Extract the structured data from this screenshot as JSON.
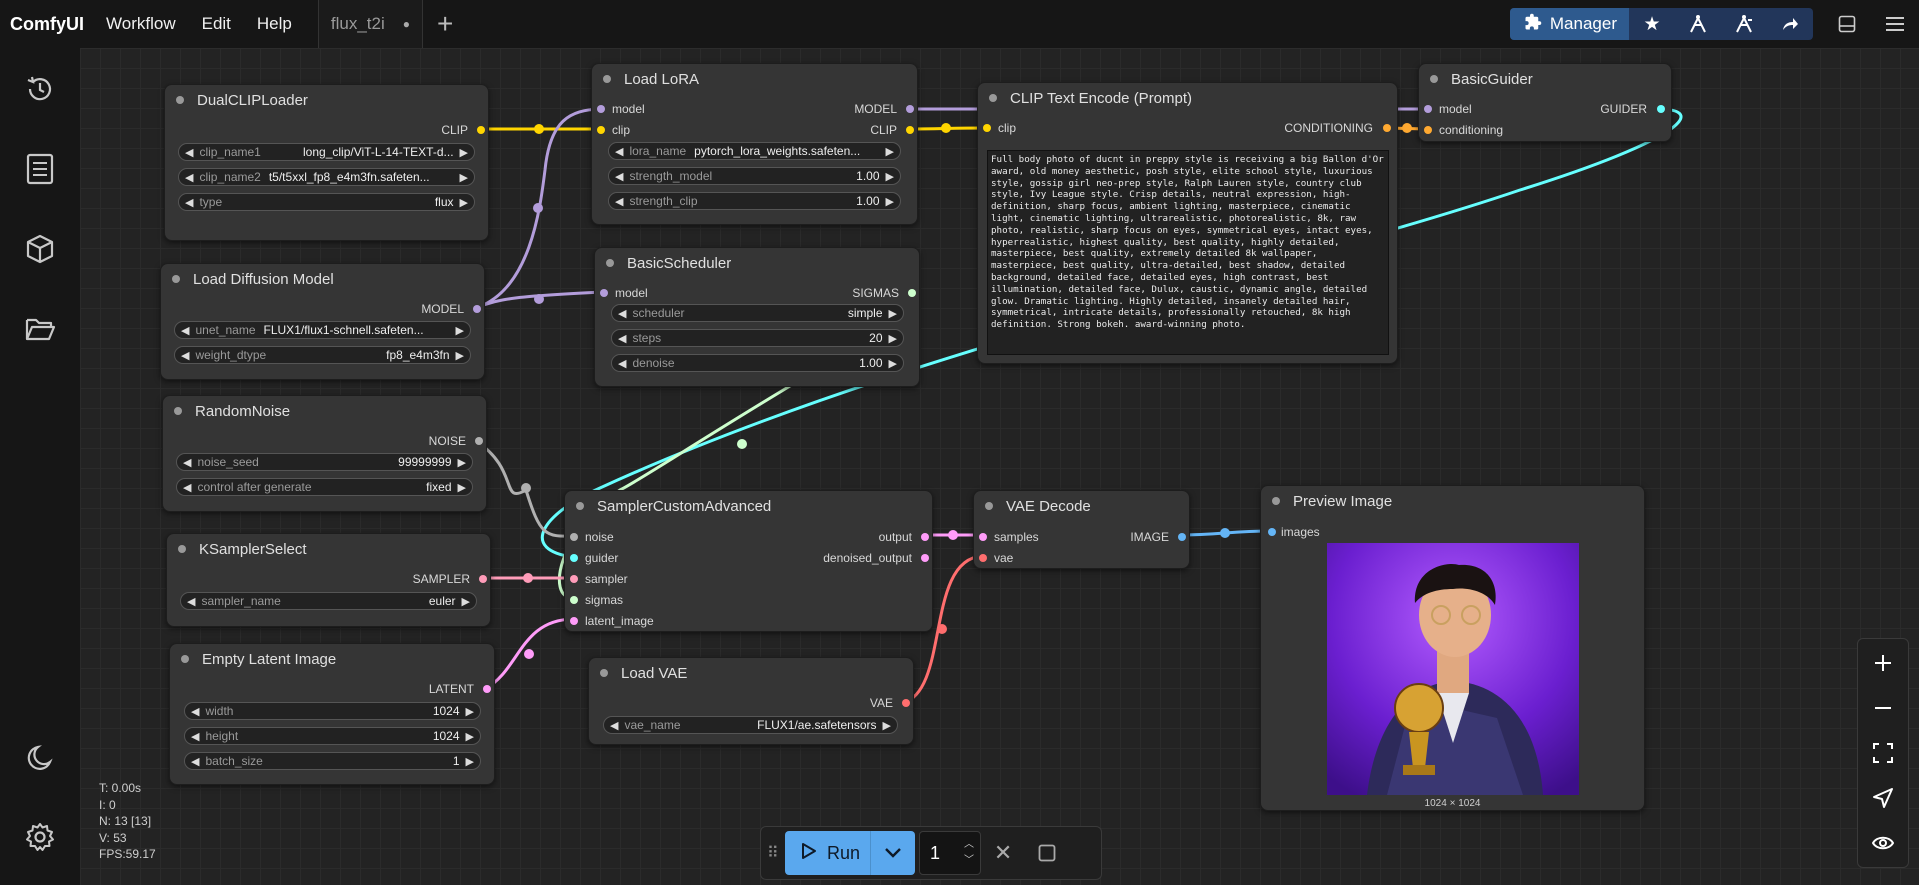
{
  "app": {
    "name": "ComfyUI"
  },
  "menu": {
    "items": [
      "Workflow",
      "Edit",
      "Help"
    ]
  },
  "workflow_tab": {
    "name": "flux_t2i",
    "unsaved_dot": "●"
  },
  "topright": {
    "manager_label": "Manager"
  },
  "stats": {
    "t": "T: 0.00s",
    "i": "I: 0",
    "n": "N: 13 [13]",
    "v": "V: 53",
    "fps": "FPS:59.17"
  },
  "nodes": {
    "dualclip": {
      "title": "DualCLIPLoader",
      "out_clip": "CLIP",
      "widgets": [
        {
          "label": "clip_name1",
          "value": "long_clip/ViT-L-14-TEXT-d..."
        },
        {
          "label": "clip_name2",
          "value": "t5/t5xxl_fp8_e4m3fn.safeten..."
        },
        {
          "label": "type",
          "value": "flux"
        }
      ]
    },
    "loadlora": {
      "title": "Load LoRA",
      "in_model": "model",
      "in_clip": "clip",
      "out_model": "MODEL",
      "out_clip": "CLIP",
      "widgets": [
        {
          "label": "lora_name",
          "value": "pytorch_lora_weights.safeten..."
        },
        {
          "label": "strength_model",
          "value": "1.00"
        },
        {
          "label": "strength_clip",
          "value": "1.00"
        }
      ]
    },
    "cliptext": {
      "title": "CLIP Text Encode (Prompt)",
      "in_clip": "clip",
      "out_cond": "CONDITIONING",
      "prompt": "Full body photo of ducnt in preppy style is receiving a big Ballon d'Or award, old money aesthetic, posh style, elite school style, luxurious style, gossip girl neo-prep style, Ralph Lauren style, country club style, Ivy League style. Crisp details, neutral expression, high-definition, sharp focus, ambient lighting, masterpiece, cinematic light, cinematic lighting, ultrarealistic, photorealistic, 8k, raw photo, realistic, sharp focus on eyes, symmetrical eyes, intact eyes, hyperrealistic, highest quality, best quality, highly detailed, masterpiece, best quality, extremely detailed 8k wallpaper, masterpiece, best quality, ultra-detailed, best shadow, detailed background, detailed face, detailed eyes, high contrast, best illumination, detailed face, Dulux, caustic, dynamic angle, detailed glow. Dramatic lighting. Highly detailed, insanely detailed hair, symmetrical, intricate details, professionally retouched, 8k high definition. Strong bokeh. award-winning photo."
    },
    "basicguider": {
      "title": "BasicGuider",
      "in_model": "model",
      "in_cond": "conditioning",
      "out_guider": "GUIDER"
    },
    "loaddiffusion": {
      "title": "Load Diffusion Model",
      "out_model": "MODEL",
      "widgets": [
        {
          "label": "unet_name",
          "value": "FLUX1/flux1-schnell.safeten..."
        },
        {
          "label": "weight_dtype",
          "value": "fp8_e4m3fn"
        }
      ]
    },
    "basicscheduler": {
      "title": "BasicScheduler",
      "in_model": "model",
      "out_sigmas": "SIGMAS",
      "widgets": [
        {
          "label": "scheduler",
          "value": "simple"
        },
        {
          "label": "steps",
          "value": "20"
        },
        {
          "label": "denoise",
          "value": "1.00"
        }
      ]
    },
    "randomnoise": {
      "title": "RandomNoise",
      "out_noise": "NOISE",
      "widgets": [
        {
          "label": "noise_seed",
          "value": "99999999"
        },
        {
          "label": "control after generate",
          "value": "fixed"
        }
      ]
    },
    "ksamplerselect": {
      "title": "KSamplerSelect",
      "out_sampler": "SAMPLER",
      "widgets": [
        {
          "label": "sampler_name",
          "value": "euler"
        }
      ]
    },
    "emptylatent": {
      "title": "Empty Latent Image",
      "out_latent": "LATENT",
      "widgets": [
        {
          "label": "width",
          "value": "1024"
        },
        {
          "label": "height",
          "value": "1024"
        },
        {
          "label": "batch_size",
          "value": "1"
        }
      ]
    },
    "sampler": {
      "title": "SamplerCustomAdvanced",
      "inputs": [
        "noise",
        "guider",
        "sampler",
        "sigmas",
        "latent_image"
      ],
      "outputs": [
        "output",
        "denoised_output"
      ]
    },
    "vaedecode": {
      "title": "VAE Decode",
      "in_samples": "samples",
      "in_vae": "vae",
      "out_image": "IMAGE"
    },
    "loadvae": {
      "title": "Load VAE",
      "out_vae": "VAE",
      "widgets": [
        {
          "label": "vae_name",
          "value": "FLUX1/ae.safetensors"
        }
      ]
    },
    "preview": {
      "title": "Preview Image",
      "in_images": "images",
      "caption": "1024 × 1024"
    }
  },
  "runbar": {
    "run_label": "Run",
    "count": "1"
  },
  "colors": {
    "clip": "#ffd500",
    "model": "#b39ddb",
    "conditioning": "#ffa931",
    "guider": "#66ffff",
    "sigmas": "#cdffcd",
    "noise": "#b0b0b0",
    "sampler": "#ff9cb9",
    "latent": "#ff9cf9",
    "vae": "#ff6e6e",
    "image": "#64b5f6",
    "accent": "#5aa8ee"
  },
  "icons": [
    "history-icon",
    "queue-icon",
    "cube-icon",
    "folder-icon",
    "moon-icon",
    "gear-icon",
    "puzzle-icon",
    "star-icon",
    "person-icon",
    "share-icon",
    "panel-icon",
    "hamburger-icon",
    "play-icon",
    "chevron-down-icon",
    "close-icon",
    "stop-icon",
    "plus-icon",
    "minus-icon",
    "fit-view-icon",
    "navigate-icon",
    "eye-icon"
  ]
}
